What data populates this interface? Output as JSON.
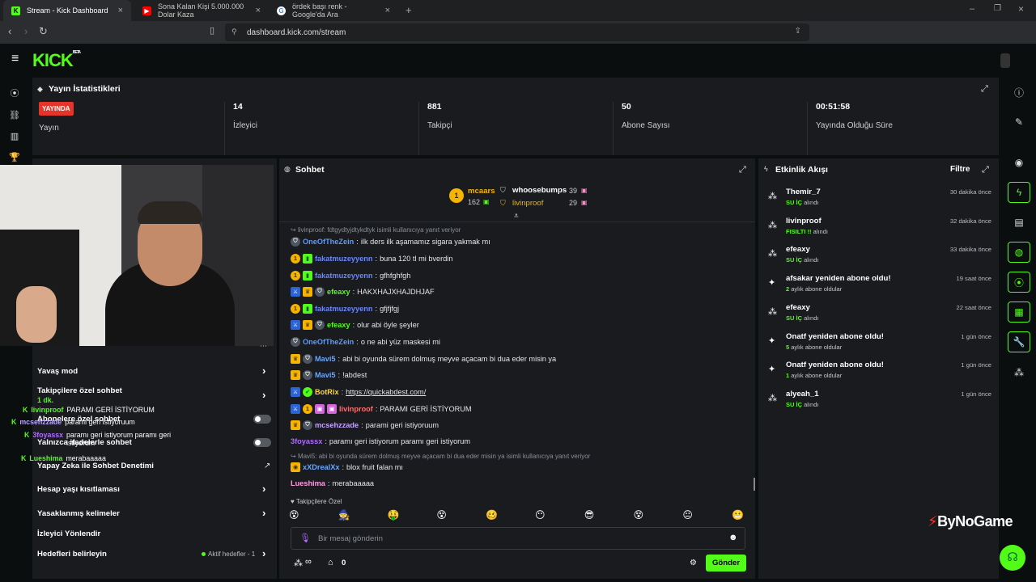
{
  "browser": {
    "tabs": [
      {
        "title": "Stream - Kick Dashboard",
        "active": true
      },
      {
        "title": "Sona Kalan Kişi 5.000.000 Dolar Kaza",
        "active": false
      },
      {
        "title": "ördek başı renk - Google'da Ara",
        "active": false
      }
    ],
    "new_tab": "+",
    "url": "dashboard.kick.com/stream"
  },
  "brand": {
    "logo": "KICK",
    "beta": "BETA",
    "accent": "#53fc18"
  },
  "stats": {
    "title": "Yayın İstatistikleri",
    "live_badge": "YAYINDA",
    "live_label": "Yayın",
    "viewers_value": "14",
    "viewers_label": "İzleyici",
    "followers_value": "881",
    "followers_label": "Takipçi",
    "subs_value": "50",
    "subs_label": "Abone Sayısı",
    "uptime_value": "00:51:58",
    "uptime_label": "Yayında Olduğu Süre"
  },
  "chat": {
    "title": "Sohbet",
    "top": {
      "first_name": "mcaars",
      "first_value": "162",
      "second_name": "whoosebumps",
      "second_value": "39",
      "third_name": "livinproof",
      "third_value": "29",
      "rank": "1"
    },
    "messages": [
      {
        "type": "reply",
        "text": "livinproof: fdtgydtyjdtykdtyk isimli kullanıcıya yanıt veriyor"
      },
      {
        "badges": [
          "shield"
        ],
        "user": "OneOfTheZein",
        "color": "#5b9cff",
        "text": "ilk ders ilk aşamamız sigara yakmak mı"
      },
      {
        "badges": [
          "coin",
          "sub"
        ],
        "user": "fakatmuzeyyenn",
        "color": "#6a86ff",
        "text": "buna 120 tl mi bverdin"
      },
      {
        "badges": [
          "coin",
          "sub"
        ],
        "user": "fakatmuzeyyenn",
        "color": "#6a86ff",
        "text": "gfhfghfgh"
      },
      {
        "badges": [
          "mod",
          "vip",
          "shield"
        ],
        "user": "efeaxy",
        "color": "#53fc18",
        "text": "HAKXHAJXHAJDHJAF"
      },
      {
        "badges": [
          "coin",
          "sub"
        ],
        "user": "fakatmuzeyyenn",
        "color": "#6a86ff",
        "text": "gfjfjfgj"
      },
      {
        "badges": [
          "mod",
          "vip",
          "shield"
        ],
        "user": "efeaxy",
        "color": "#53fc18",
        "text": "olur abi öyle şeyler"
      },
      {
        "badges": [
          "shield"
        ],
        "user": "OneOfTheZein",
        "color": "#5b9cff",
        "text": "o ne abi yüz maskesi mi"
      },
      {
        "badges": [
          "vip",
          "shield"
        ],
        "user": "Mavi5",
        "color": "#6aa8ff",
        "text": "abi bi oyunda sürem dolmuş meyve açacam bi dua eder misin ya"
      },
      {
        "badges": [
          "vip",
          "shield"
        ],
        "user": "Mavi5",
        "color": "#6aa8ff",
        "text": "!abdest"
      },
      {
        "badges": [
          "mod",
          "bot"
        ],
        "user": "BotRix",
        "color": "#ffd53d",
        "text": "https://quickabdest.com/"
      },
      {
        "badges": [
          "mod",
          "coin",
          "pink",
          "pink"
        ],
        "user": "livinproof",
        "color": "#ff6e6e",
        "text": "PARAMI GERİ İSTİYORUM"
      },
      {
        "badges": [
          "vip",
          "shield"
        ],
        "user": "mcsehzzade",
        "color": "#c6a3ff",
        "text": "parami geri istiyoruum"
      },
      {
        "badges": [],
        "user": "3foyassx",
        "color": "#b06bff",
        "text": "paramı geri istiyorum paramı geri istiyorum"
      },
      {
        "type": "reply",
        "text": "Mavi5: abi bi oyunda sürem dolmuş meyve açacam bi dua eder misin ya isimli kullanıcıya yanıt veriyor"
      },
      {
        "badges": [
          "avatar"
        ],
        "user": "xXDrealXx",
        "color": "#6aa8ff",
        "text": "blox fruit falan mı"
      },
      {
        "badges": [],
        "user": "Lueshima",
        "color": "#ff9de0",
        "text": "merabaaaaa"
      }
    ],
    "followers_only": "Takipçilere Özel",
    "emotes": [
      "😵",
      "🧙",
      "🤑",
      "😵",
      "🥴",
      "😶",
      "😎",
      "😵",
      "😐",
      "😬"
    ],
    "input_placeholder": "Bir mesaj gönderin",
    "infinity": "∞",
    "store_count": "0",
    "send_label": "Gönder"
  },
  "activity": {
    "title": "Etkinlik Akışı",
    "filter": "Filtre",
    "items": [
      {
        "icon": "dots",
        "name": "Themir_7",
        "sub_hi": "SU İÇ",
        "sub": " alındı",
        "time": "30 dakika önce"
      },
      {
        "icon": "dots",
        "name": "livinproof",
        "sub_hi": "FISILTI !!",
        "sub": " alındı",
        "time": "32 dakika önce"
      },
      {
        "icon": "dots",
        "name": "efeaxy",
        "sub_hi": "SU İÇ",
        "sub": " alındı",
        "time": "33 dakika önce"
      },
      {
        "icon": "star",
        "name": "afsakar yeniden abone oldu!",
        "sub_hi": "2",
        "sub": " aylık abone oldular",
        "time": "19 saat önce"
      },
      {
        "icon": "dots",
        "name": "efeaxy",
        "sub_hi": "SU İÇ",
        "sub": " alındı",
        "time": "22 saat önce"
      },
      {
        "icon": "star",
        "name": "Onatf yeniden abone oldu!",
        "sub_hi": "5",
        "sub": " aylık abone oldular",
        "time": "1 gün önce"
      },
      {
        "icon": "star",
        "name": "Onatf yeniden abone oldu!",
        "sub_hi": "1",
        "sub": " aylık abone oldular",
        "time": "1 gün önce"
      },
      {
        "icon": "dots",
        "name": "alyeah_1",
        "sub_hi": "SU İÇ",
        "sub": " alındı",
        "time": "1 gün önce"
      }
    ]
  },
  "settings": {
    "items": [
      {
        "label": "Yavaş mod",
        "control": "chevron"
      },
      {
        "label": "Takipçilere özel sohbet",
        "control": "chevron"
      },
      {
        "label": "Abonelere özel sohbet",
        "control": "toggle"
      },
      {
        "label": "Yalnızca ifadelerle sohbet",
        "control": "toggle"
      },
      {
        "label": "Yapay Zeka ile Sohbet Denetimi",
        "control": "external"
      },
      {
        "label": "Hesap yaşı kısıtlaması",
        "control": "chevron"
      },
      {
        "label": "Yasaklanmış kelimeler",
        "control": "chevron"
      },
      {
        "label": "İzleyici Yönlendir",
        "control": "none"
      },
      {
        "label": "Hedefleri belirleyin",
        "control": "chevron"
      }
    ],
    "goals_status": "Aktif hedefler - 1"
  },
  "overlay": {
    "chat": [
      {
        "user": "livinproof",
        "text": "PARAMI GERİ İSTİYORUM"
      },
      {
        "user": "mcsehzzade",
        "text": "parami geri istiyoruum"
      },
      {
        "user": "3foyassx",
        "text": "paramı geri istiyorum paramı geri istiyorum"
      },
      {
        "user": "Lueshima",
        "text": "merabaaaaa"
      }
    ],
    "follow_line": "1 dk.",
    "watermark": "ByNoGame"
  }
}
